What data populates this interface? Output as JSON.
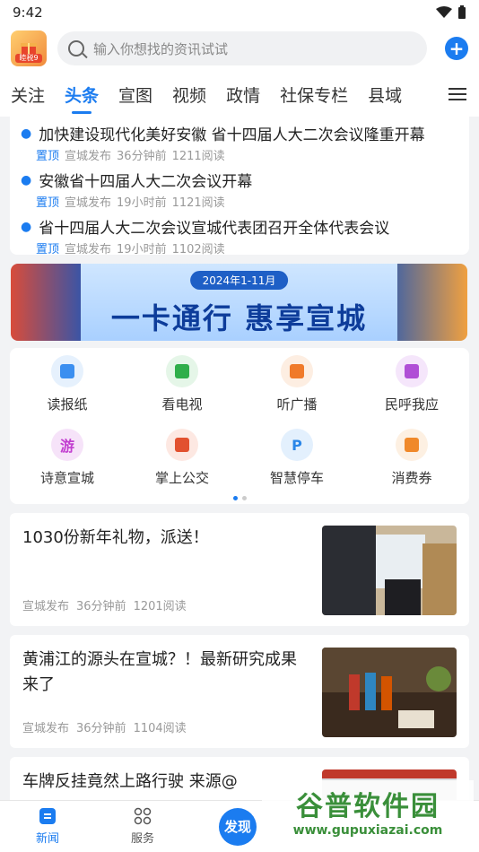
{
  "status_bar": {
    "time": "9:42"
  },
  "header": {
    "logo_tag": "睦税9",
    "search_placeholder": "输入你想找的资讯试试",
    "add_label": "+"
  },
  "tabs": [
    "关注",
    "头条",
    "宣图",
    "视频",
    "政情",
    "社保专栏",
    "县域"
  ],
  "active_tab": "头条",
  "pinned": [
    {
      "title": "加快建设现代化美好安徽  省十四届人大二次会议隆重开幕",
      "tag": "置顶",
      "source": "宣城发布",
      "time": "36分钟前",
      "reads": "1211阅读"
    },
    {
      "title": "安徽省十四届人大二次会议开幕",
      "tag": "置顶",
      "source": "宣城发布",
      "time": "19小时前",
      "reads": "1121阅读"
    },
    {
      "title": "省十四届人大二次会议宣城代表团召开全体代表会议",
      "tag": "置顶",
      "source": "宣城发布",
      "time": "19小时前",
      "reads": "1102阅读"
    }
  ],
  "banner": {
    "date": "2024年1-11月",
    "slogan": "一卡通行  惠享宣城"
  },
  "services": [
    {
      "label": "读报纸",
      "icon": "newspaper-icon",
      "color": "#3b8ff0",
      "bg": "#e6f1fd"
    },
    {
      "label": "看电视",
      "icon": "tv-icon",
      "color": "#2fae4a",
      "bg": "#e5f6e8"
    },
    {
      "label": "听广播",
      "icon": "radio-icon",
      "color": "#f07a2a",
      "bg": "#fdeee2"
    },
    {
      "label": "民呼我应",
      "icon": "chat-icon",
      "color": "#b04fd6",
      "bg": "#f5e6fb"
    },
    {
      "label": "诗意宣城",
      "icon": "poetry-icon",
      "color": "#c23fd0",
      "bg": "#f6e3f9",
      "glyph": "游"
    },
    {
      "label": "掌上公交",
      "icon": "bus-icon",
      "color": "#e2512f",
      "bg": "#fde8e2"
    },
    {
      "label": "智慧停车",
      "icon": "parking-icon",
      "color": "#2a86e8",
      "bg": "#e3f0fd",
      "glyph": "P"
    },
    {
      "label": "消费券",
      "icon": "coupon-icon",
      "color": "#f0892a",
      "bg": "#fdf0e2"
    }
  ],
  "articles": [
    {
      "title": "1030份新年礼物，派送！",
      "source": "宣城发布",
      "time": "36分钟前",
      "reads": "1201阅读"
    },
    {
      "title": "黄浦江的源头在宣城？！最新研究成果来了",
      "source": "宣城发布",
      "time": "36分钟前",
      "reads": "1104阅读"
    },
    {
      "title": "车牌反挂竟然上路行驶 来源@",
      "source": "",
      "time": "",
      "reads": ""
    }
  ],
  "bottom_nav": {
    "news": "新闻",
    "services": "服务",
    "discover": "发现"
  },
  "watermark": {
    "big": "谷普软件园",
    "small": "www.gupuxiazai.com"
  }
}
